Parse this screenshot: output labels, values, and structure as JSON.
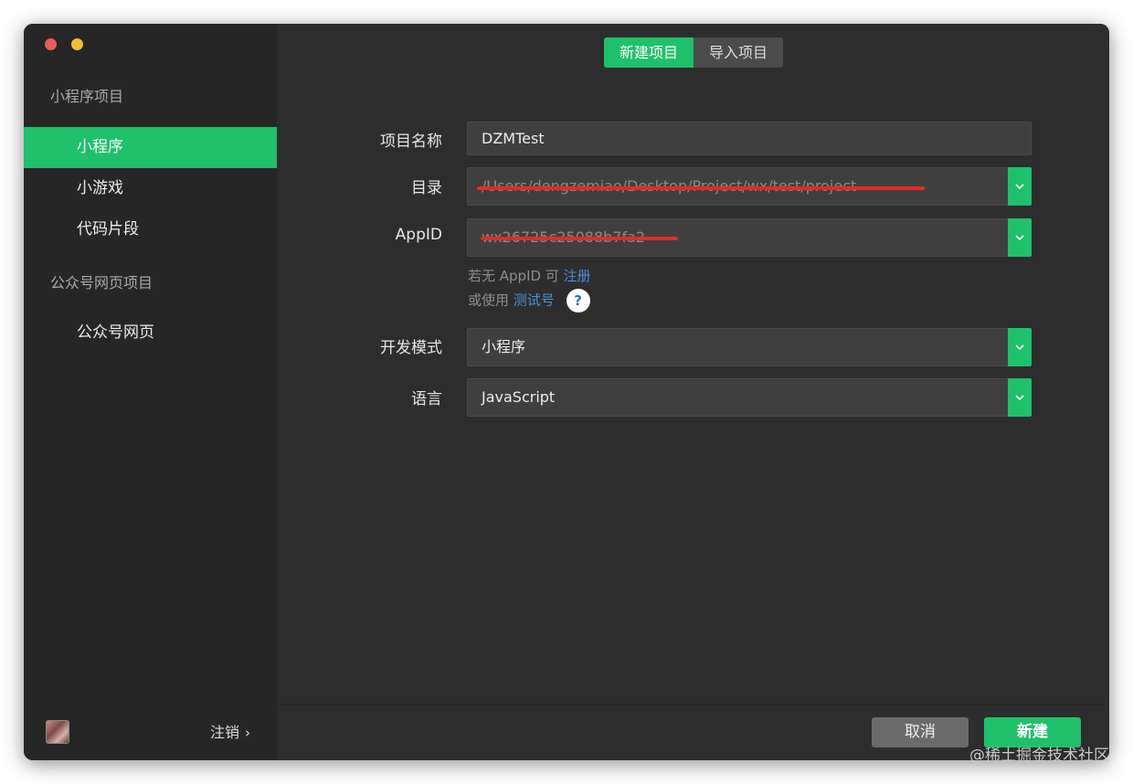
{
  "sidebar": {
    "section_mini": "小程序项目",
    "items_mini": [
      {
        "label": "小程序"
      },
      {
        "label": "小游戏"
      },
      {
        "label": "代码片段"
      }
    ],
    "section_public": "公众号网页项目",
    "items_public": [
      {
        "label": "公众号网页"
      }
    ],
    "logout_label": "注销",
    "logout_chevron": "›"
  },
  "tabs": {
    "new_project": "新建项目",
    "import_project": "导入项目"
  },
  "form": {
    "name_label": "项目名称",
    "name_value": "DZMTest",
    "dir_label": "目录",
    "dir_value": "/Users/dengzemiao/Desktop/Project/wx/test/project",
    "appid_label": "AppID",
    "appid_value": "wx26725c25088b7fa2",
    "hint_no_appid": "若无 AppID 可",
    "hint_register_link": "注册",
    "hint_or_use": "或使用",
    "hint_test_link": "测试号",
    "help_icon_glyph": "?",
    "mode_label": "开发模式",
    "mode_value": "小程序",
    "lang_label": "语言",
    "lang_value": "JavaScript"
  },
  "footer": {
    "cancel_label": "取消",
    "create_label": "新建"
  },
  "watermark": "@稀土掘金技术社区",
  "colors": {
    "accent": "#1fc16b",
    "link": "#4a8fe0",
    "redaction": "#e52a28"
  },
  "icons": [
    "chevron-down-icon",
    "help-icon",
    "chevron-right-icon",
    "avatar"
  ]
}
